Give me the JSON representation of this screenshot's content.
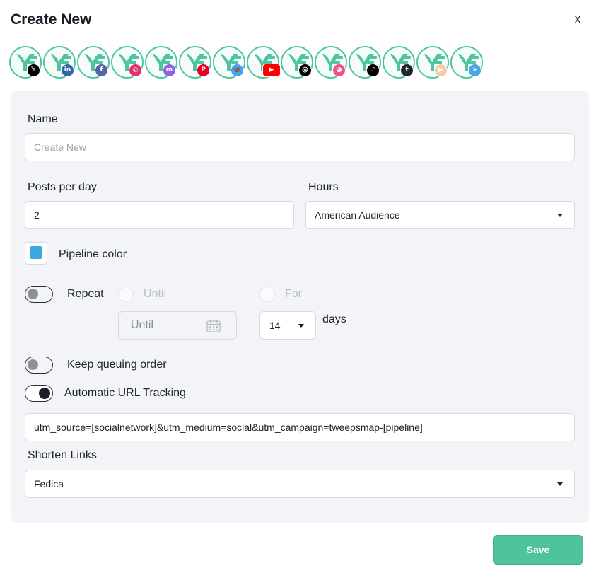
{
  "modal": {
    "title": "Create New",
    "close_label": "x"
  },
  "accounts": [
    {
      "network": "x",
      "badge_text": "𝕏",
      "badge_color": "#000000"
    },
    {
      "network": "linkedin",
      "badge_text": "in",
      "badge_color": "#2f6aa8"
    },
    {
      "network": "facebook",
      "badge_text": "f",
      "badge_color": "#5067a8"
    },
    {
      "network": "instagram",
      "badge_text": "◎",
      "badge_color": "#e1306c"
    },
    {
      "network": "mastodon",
      "badge_text": "m",
      "badge_color": "#8f63e6"
    },
    {
      "network": "pinterest",
      "badge_text": "P",
      "badge_color": "#e60023"
    },
    {
      "network": "bluesky",
      "badge_text": "🦋",
      "badge_color": "#4a9ff5"
    },
    {
      "network": "youtube",
      "badge_text": "▶",
      "badge_color": "#ff0000"
    },
    {
      "network": "threads",
      "badge_text": "@",
      "badge_color": "#000000"
    },
    {
      "network": "gmb",
      "badge_text": "◕",
      "badge_color": "#f24f8c"
    },
    {
      "network": "tiktok",
      "badge_text": "♪",
      "badge_color": "#000000"
    },
    {
      "network": "tumblr",
      "badge_text": "t",
      "badge_color": "#1e2430"
    },
    {
      "network": "substack",
      "badge_text": "▶",
      "badge_color": "#f6c9a8"
    },
    {
      "network": "telegram",
      "badge_text": "➤",
      "badge_color": "#46a9e6"
    }
  ],
  "form": {
    "name_label": "Name",
    "name_placeholder": "Create New",
    "posts_label": "Posts per day",
    "posts_value": "2",
    "hours_label": "Hours",
    "hours_value": "American Audience",
    "pipeline_color_label": "Pipeline color",
    "pipeline_color": "#3aa8dc",
    "repeat_label": "Repeat",
    "until_label": "Until",
    "for_label": "For",
    "until_placeholder": "Until",
    "days_value": "14",
    "days_label": "days",
    "keep_queue_label": "Keep queuing order",
    "url_tracking_label": "Automatic URL Tracking",
    "url_tracking_value": "utm_source=[socialnetwork]&utm_medium=social&utm_campaign=tweepsmap-[pipeline]",
    "shorten_label": "Shorten Links",
    "shorten_value": "Fedica"
  },
  "toggles": {
    "repeat": false,
    "keep_queue": false,
    "url_tracking": true
  },
  "save_label": "Save",
  "colors": {
    "accent": "#4fc39e",
    "panel_bg": "#f3f4f8"
  }
}
